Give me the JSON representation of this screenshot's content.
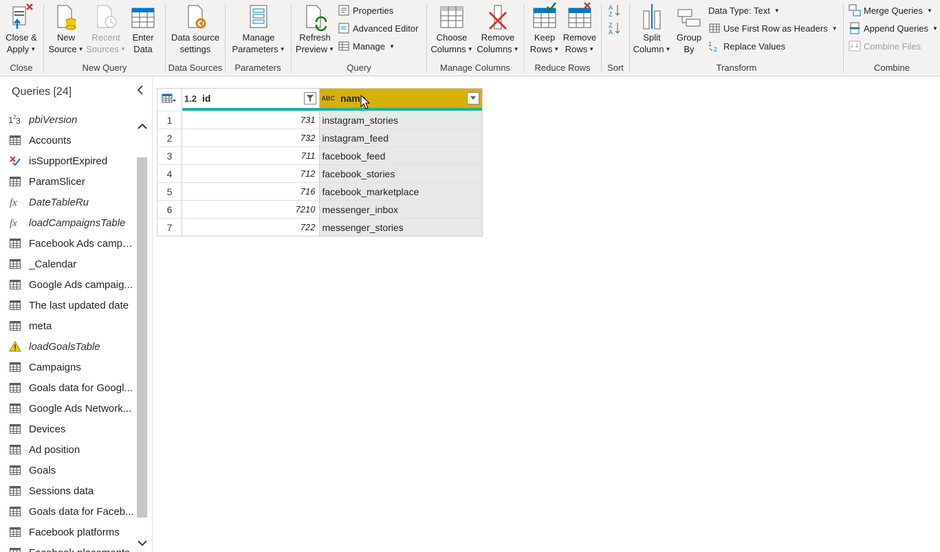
{
  "ribbon": {
    "groups": {
      "close": "Close",
      "new_query": "New Query",
      "data_sources": "Data Sources",
      "parameters": "Parameters",
      "query": "Query",
      "manage_columns": "Manage Columns",
      "reduce_rows": "Reduce Rows",
      "sort": "Sort",
      "transform": "Transform",
      "combine": "Combine"
    },
    "buttons": {
      "close_apply_1": "Close &",
      "close_apply_2": "Apply",
      "new_source_1": "New",
      "new_source_2": "Source",
      "recent_sources_1": "Recent",
      "recent_sources_2": "Sources",
      "enter_data_1": "Enter",
      "enter_data_2": "Data",
      "data_source_settings_1": "Data source",
      "data_source_settings_2": "settings",
      "manage_parameters_1": "Manage",
      "manage_parameters_2": "Parameters",
      "refresh_preview_1": "Refresh",
      "refresh_preview_2": "Preview",
      "properties": "Properties",
      "advanced_editor": "Advanced Editor",
      "manage": "Manage",
      "choose_columns_1": "Choose",
      "choose_columns_2": "Columns",
      "remove_columns_1": "Remove",
      "remove_columns_2": "Columns",
      "keep_rows_1": "Keep",
      "keep_rows_2": "Rows",
      "remove_rows_1": "Remove",
      "remove_rows_2": "Rows",
      "split_column_1": "Split",
      "split_column_2": "Column",
      "group_by_1": "Group",
      "group_by_2": "By",
      "data_type": "Data Type: Text",
      "use_first_row": "Use First Row as Headers",
      "replace_values": "Replace Values",
      "merge_queries": "Merge Queries",
      "append_queries": "Append Queries",
      "combine_files": "Combine Files"
    }
  },
  "queries": {
    "title": "Queries [24]",
    "items": [
      {
        "name": "pbiVersion",
        "icon": "number-icon",
        "italic": true
      },
      {
        "name": "Accounts",
        "icon": "table-icon",
        "italic": false
      },
      {
        "name": "isSupportExpired",
        "icon": "boolean-icon",
        "italic": false
      },
      {
        "name": "ParamSlicer",
        "icon": "table-icon",
        "italic": false
      },
      {
        "name": "DateTableRu",
        "icon": "function-icon",
        "italic": true
      },
      {
        "name": "loadCampaignsTable",
        "icon": "function-icon",
        "italic": true
      },
      {
        "name": "Facebook Ads campa...",
        "icon": "table-icon",
        "italic": false
      },
      {
        "name": "_Calendar",
        "icon": "table-icon",
        "italic": false
      },
      {
        "name": "Google Ads campaig...",
        "icon": "table-icon",
        "italic": false
      },
      {
        "name": "The last updated date",
        "icon": "table-icon",
        "italic": false
      },
      {
        "name": "meta",
        "icon": "table-icon",
        "italic": false
      },
      {
        "name": "loadGoalsTable",
        "icon": "warning-icon",
        "italic": true
      },
      {
        "name": "Campaigns",
        "icon": "table-icon",
        "italic": false
      },
      {
        "name": "Goals data for Googl...",
        "icon": "table-icon",
        "italic": false
      },
      {
        "name": "Google Ads Network...",
        "icon": "table-icon",
        "italic": false
      },
      {
        "name": "Devices",
        "icon": "table-icon",
        "italic": false
      },
      {
        "name": "Ad position",
        "icon": "table-icon",
        "italic": false
      },
      {
        "name": "Goals",
        "icon": "table-icon",
        "italic": false
      },
      {
        "name": "Sessions data",
        "icon": "table-icon",
        "italic": false
      },
      {
        "name": "Goals data for Faceb...",
        "icon": "table-icon",
        "italic": false
      },
      {
        "name": "Facebook platforms",
        "icon": "table-icon",
        "italic": false
      },
      {
        "name": "Facebook placements",
        "icon": "table-icon",
        "italic": false
      }
    ]
  },
  "grid": {
    "columns": [
      {
        "type": "1.2",
        "name": "id"
      },
      {
        "type": "ABC",
        "name": "name"
      }
    ],
    "rows": [
      {
        "n": "1",
        "id": "731",
        "name": "instagram_stories"
      },
      {
        "n": "2",
        "id": "732",
        "name": "instagram_feed"
      },
      {
        "n": "3",
        "id": "711",
        "name": "facebook_feed"
      },
      {
        "n": "4",
        "id": "712",
        "name": "facebook_stories"
      },
      {
        "n": "5",
        "id": "716",
        "name": "facebook_marketplace"
      },
      {
        "n": "6",
        "id": "7210",
        "name": "messenger_inbox"
      },
      {
        "n": "7",
        "id": "722",
        "name": "messenger_stories"
      }
    ]
  },
  "colors": {
    "selected_column": "#d7b00b",
    "quality_bar": "#12b5a3",
    "ribbon_bg": "#f3f2f1"
  }
}
